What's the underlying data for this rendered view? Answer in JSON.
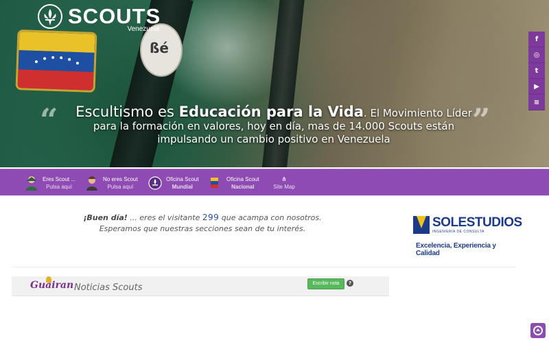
{
  "brand": {
    "name": "SCOUTS",
    "subtitle": "Venezuela"
  },
  "hero": {
    "lead": "Escultismo es ",
    "emphasis": "Educación para la Vida",
    "rest": ". El Movimiento Líder para la formación en valores, hoy en día, mas de 14.000 Scouts están impulsando un cambio positivo en Venezuela",
    "badge_number": "ßé"
  },
  "social": [
    {
      "icon": "facebook-icon",
      "glyph": "f"
    },
    {
      "icon": "instagram-icon",
      "glyph": "◎"
    },
    {
      "icon": "twitter-icon",
      "glyph": "t"
    },
    {
      "icon": "youtube-icon",
      "glyph": "▶"
    },
    {
      "icon": "rss-icon",
      "glyph": "≋"
    }
  ],
  "nav": [
    {
      "line1": "Eres Scout ...",
      "line2": "Pulsa aquí"
    },
    {
      "line1": "No eres Scout",
      "line2": "Pulsa aquí"
    },
    {
      "line1": "Oficina Scout",
      "line2": "Mundial"
    },
    {
      "line1": "Oficina Scout",
      "line2": "Nacional"
    },
    {
      "line1": "",
      "line2": "Site Map"
    }
  ],
  "greeting": {
    "hi": "¡Buen día!",
    "before_count": " ... eres el visitante ",
    "count": "299",
    "after_count": " que acampa con nosotros.",
    "line2": "Esperamos que nuestras secciones sean de tu interés."
  },
  "ad": {
    "name": "SOLESTUDIOS",
    "sub": "INGENIERÍA DE CONSULTA",
    "slogan": "Excelencia, Experiencia y Calidad"
  },
  "news": {
    "logo": "Guairan",
    "title": "Noticias Scouts",
    "write_label": "Escribir nota",
    "help": "?"
  },
  "colors": {
    "purple": "#8e4bb3",
    "accent_blue": "#2a4ea0",
    "green_button": "#58b85c"
  }
}
